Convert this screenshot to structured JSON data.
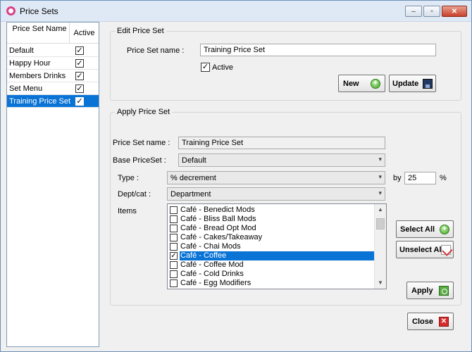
{
  "window": {
    "title": "Price Sets",
    "minimize": "‒",
    "maximize": "▫",
    "close": "✕"
  },
  "price_sets_list": {
    "header_name": "Price Set Name",
    "header_active": "Active",
    "rows": [
      {
        "name": "Default",
        "active": "✓"
      },
      {
        "name": "Happy Hour",
        "active": "✓"
      },
      {
        "name": "Members Drinks",
        "active": "✓"
      },
      {
        "name": "Set Menu",
        "active": "✓"
      },
      {
        "name": "Training Price Set",
        "active": "✓"
      }
    ]
  },
  "edit_price_set": {
    "group_title": "Edit Price Set",
    "name_label": "Price Set name :",
    "name_value": "Training Price Set",
    "active_check": "✓",
    "active_label": "Active",
    "new_label": "New",
    "update_label": "Update"
  },
  "apply_price_set": {
    "group_title": "Apply Price Set",
    "name_label": "Price Set name :",
    "name_value": "Training Price Set",
    "base_label": "Base PriceSet :",
    "base_value": "Default",
    "type_label": "Type :",
    "type_value": "% decrement",
    "by_label": "by",
    "by_value": "25",
    "percent_label": "%",
    "dept_label": "Dept/cat :",
    "dept_value": "Department",
    "items_label": "Items",
    "items": [
      {
        "label": "Café - Benedict Mods",
        "check": ""
      },
      {
        "label": "Café - Bliss Ball Mods",
        "check": ""
      },
      {
        "label": "Café - Bread Opt Mod",
        "check": ""
      },
      {
        "label": "Café - Cakes/Takeaway",
        "check": ""
      },
      {
        "label": "Café - Chai Mods",
        "check": ""
      },
      {
        "label": "Café - Coffee",
        "check": "✓"
      },
      {
        "label": "Café - Coffee Mod",
        "check": ""
      },
      {
        "label": "Café - Cold Drinks",
        "check": ""
      },
      {
        "label": "Café - Egg Modifiers",
        "check": ""
      }
    ],
    "select_all_label": "Select All",
    "unselect_all_label": "Unselect All",
    "apply_label": "Apply"
  },
  "close_label": "Close",
  "icons": {
    "app": "price-sets-app-icon",
    "new": "green-plus-icon",
    "update": "save-disk-icon",
    "select_all": "green-plus-icon",
    "unselect_all": "clear-sheet-icon",
    "apply": "green-apply-icon",
    "close": "red-x-icon"
  },
  "colors": {
    "selection": "#0a73d6",
    "titlebar": "#dfe9f5",
    "window_bg": "#f0f0f0"
  }
}
